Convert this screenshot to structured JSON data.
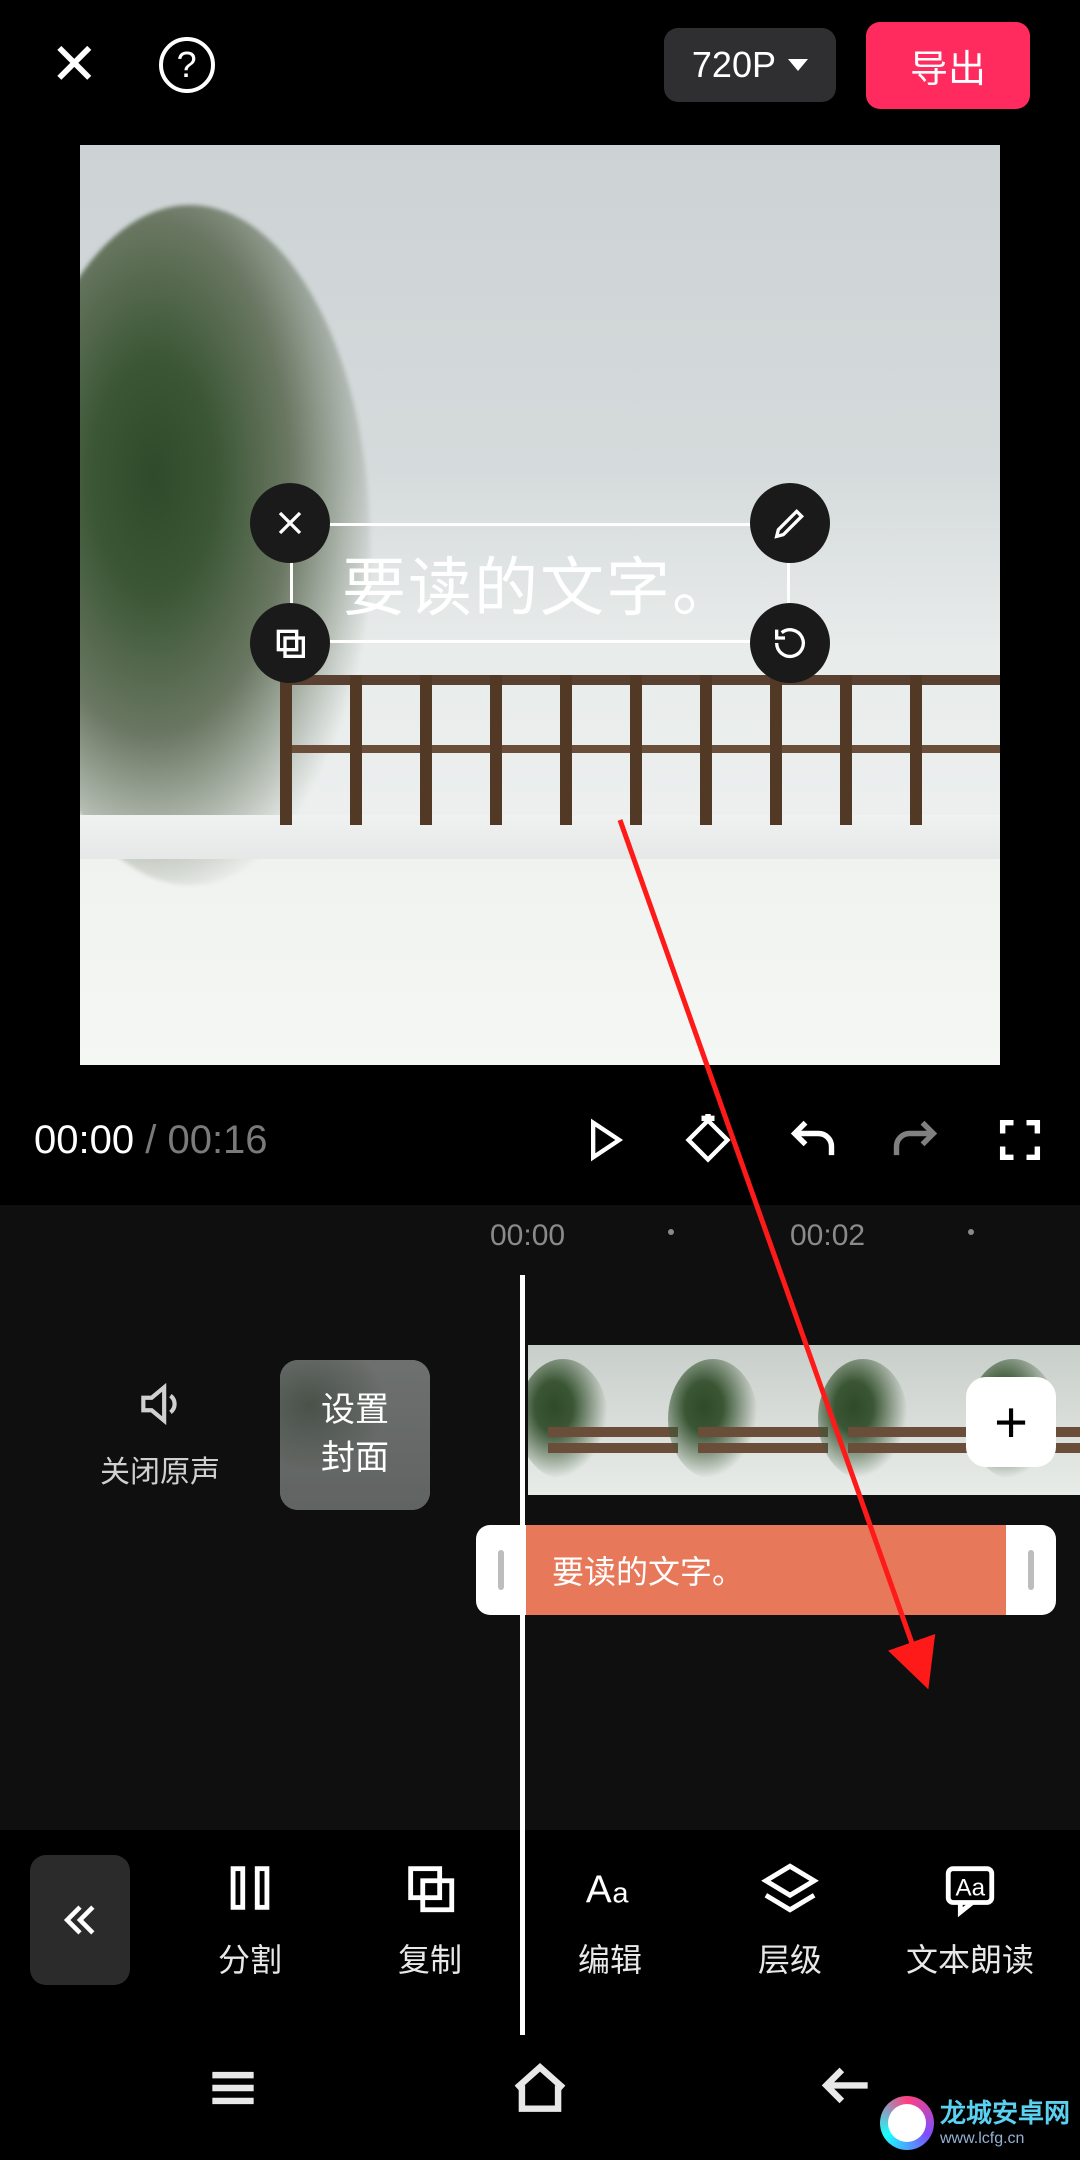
{
  "header": {
    "resolution": "720P",
    "export_label": "导出"
  },
  "overlay": {
    "text": "要读的文字。"
  },
  "playback": {
    "current": "00:00",
    "duration": "00:16"
  },
  "ruler": {
    "marks": [
      "00:00",
      "00:02"
    ]
  },
  "timeline": {
    "mute_label": "关闭原声",
    "cover_label": "设置\n封面",
    "text_clip": "要读的文字。"
  },
  "tools": [
    {
      "id": "split",
      "label": "分割"
    },
    {
      "id": "copy",
      "label": "复制"
    },
    {
      "id": "edit",
      "label": "编辑"
    },
    {
      "id": "layer",
      "label": "层级"
    },
    {
      "id": "tts",
      "label": "文本朗读"
    }
  ],
  "watermark": {
    "title": "龙城安卓网",
    "url": "www.lcfg.cn"
  }
}
